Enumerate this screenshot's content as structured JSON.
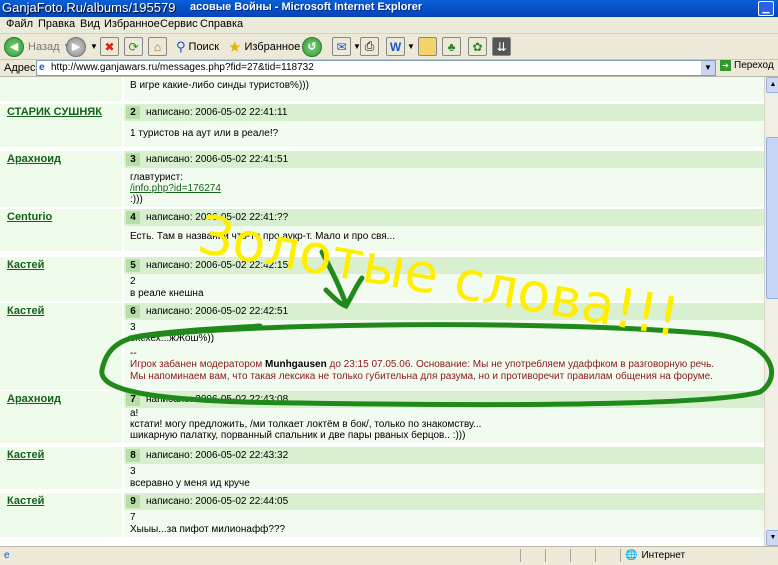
{
  "window": {
    "watermark": "GanjaFoto.Ru/albums/195579",
    "title": "асовые Войны - Microsoft Internet Explorer"
  },
  "menu": [
    "Файл",
    "Правка",
    "Вид",
    "Избранное",
    "Сервис",
    "Справка"
  ],
  "toolbar": {
    "back": "Назад",
    "search": "Поиск",
    "favorites": "Избранное"
  },
  "address": {
    "label": "Адрес:",
    "url": "http://www.ganjawars.ru/messages.php?fid=27&tid=118732",
    "go": "Переход"
  },
  "top_line": "В игре какие-либо синды туристов%)))",
  "posts": [
    {
      "num": "2",
      "author": "СТАРИК СУШНЯК",
      "meta": "написано: 2006-05-02 22:41:11",
      "lines": [
        "1 туристов на аут или в реале!?"
      ]
    },
    {
      "num": "3",
      "author": "Арахноид",
      "meta": "написано: 2006-05-02 22:41:51",
      "lines": [
        "главтурист:",
        "/info.php?id=176274",
        ":)))"
      ]
    },
    {
      "num": "4",
      "author": "Centurio",
      "meta": "написано: 2006-05-02 22:41:??",
      "lines": [
        "Есть. Там в названии что-то про аукр-т. Мало и про свя..."
      ]
    },
    {
      "num": "5",
      "author": "Кастей",
      "meta": "написано: 2006-05-02 22:42:15",
      "lines": [
        "2",
        "в реале кнешна"
      ]
    },
    {
      "num": "6",
      "author": "Кастей",
      "meta": "написано: 2006-05-02 22:42:51",
      "lines": [
        "3",
        "ехехех...жЖош%))",
        "--"
      ]
    },
    {
      "num": "7",
      "author": "Арахноид",
      "meta": "написано: 2006-05-02 22:43:08",
      "lines": [
        "а!",
        "кстати! могу предложить, /ми толкает локтём в бок/, только по знакомству...",
        "шикарную палатку, порванный спальник и две пары рваных берцов.. :)))"
      ]
    },
    {
      "num": "8",
      "author": "Кастей",
      "meta": "написано: 2006-05-02 22:43:32",
      "lines": [
        "3",
        "всеравно у меня ид круче"
      ]
    },
    {
      "num": "9",
      "author": "Кастей",
      "meta": "написано: 2006-05-02 22:44:05",
      "lines": [
        "7",
        "Хыыы...за пифот милионафф???"
      ]
    }
  ],
  "ban": {
    "prefix": "Игрок забанен модератором ",
    "moderator": "Munhgausen",
    "line1_rest": " до 23:15 07.05.06. Основание: Мы не употребляем удаффком в разговорную речь.",
    "line2": "Мы напоминаем вам, что такая лексика не только губительна для разума, но и противоречит правилам общения на форуме."
  },
  "annotation": {
    "text": "Золотые слова!!!",
    "color": "#ffee00",
    "circle_color": "#1f8a1a"
  },
  "status": {
    "zone": "Интернет"
  }
}
